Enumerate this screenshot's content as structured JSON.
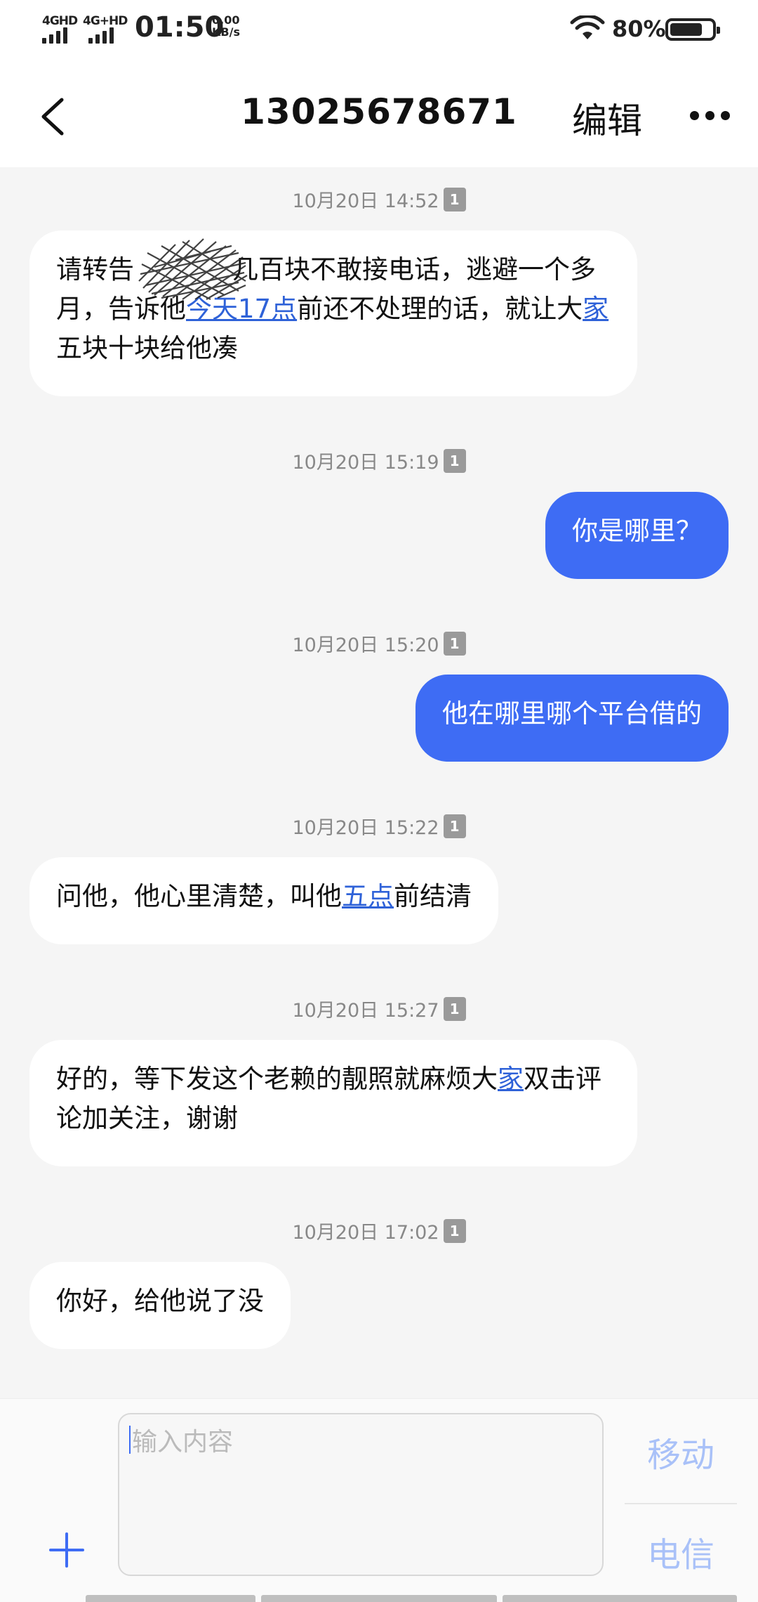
{
  "status_bar": {
    "network1": "4GHD",
    "network2": "4G+HD",
    "time": "01:50",
    "speed_value": "0.00",
    "speed_unit": "KB/s",
    "battery_percent": "80%",
    "battery_level": 0.8
  },
  "header": {
    "title": "13025678671",
    "edit_label": "编辑",
    "back_icon": "chevron-left-icon",
    "more_icon": "more-horizontal-icon"
  },
  "messages": [
    {
      "timestamp": "10月20日 14:52",
      "sim": "1",
      "direction": "in",
      "segments": [
        {
          "text": "请转告"
        },
        {
          "text": "几百块不敢接电话，逃避一个多月，告诉他"
        },
        {
          "text": "今天17点",
          "link": true
        },
        {
          "text": "前还不处理的话，就让大"
        },
        {
          "text": "家",
          "link": true
        },
        {
          "text": "五块十块给他凑"
        }
      ]
    },
    {
      "timestamp": "10月20日 15:19",
      "sim": "1",
      "direction": "out",
      "text": "你是哪里？"
    },
    {
      "timestamp": "10月20日 15:20",
      "sim": "1",
      "direction": "out",
      "text": "他在哪里哪个平台借的"
    },
    {
      "timestamp": "10月20日 15:22",
      "sim": "1",
      "direction": "in",
      "segments": [
        {
          "text": "问他，他心里清楚，叫他"
        },
        {
          "text": "五点",
          "link": true
        },
        {
          "text": "前结清"
        }
      ]
    },
    {
      "timestamp": "10月20日 15:27",
      "sim": "1",
      "direction": "in",
      "segments": [
        {
          "text": "好的，等下发这个老赖的靓照就麻烦大"
        },
        {
          "text": "家",
          "link": true
        },
        {
          "text": "双击评论加关注，谢谢"
        }
      ]
    },
    {
      "timestamp": "10月20日 17:02",
      "sim": "1",
      "direction": "in",
      "segments": [
        {
          "text": "你好，给他说了没"
        }
      ]
    }
  ],
  "composer": {
    "placeholder": "输入内容",
    "add_icon": "plus-icon",
    "send_sim1_label": "移动",
    "send_sim2_label": "电信"
  },
  "colors": {
    "accent": "#3e6cf4",
    "link": "#2f62d8",
    "send_disabled": "#a9c1f8",
    "background": "#f5f5f5"
  }
}
